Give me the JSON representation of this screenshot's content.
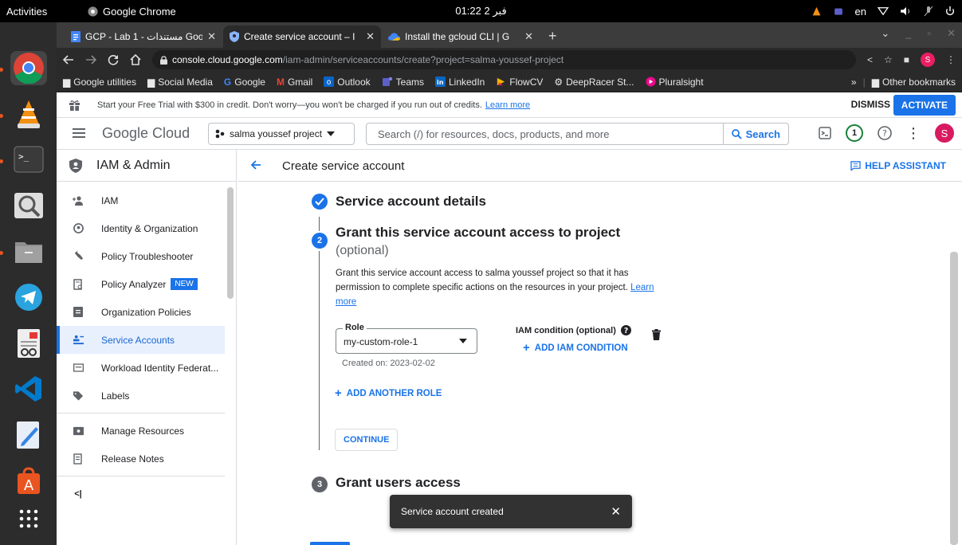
{
  "os": {
    "activities": "Activities",
    "app_name": "Google Chrome",
    "clock": "01:22 فبر 2",
    "language": "en"
  },
  "browser": {
    "tabs": [
      {
        "title": "GCP - Lab 1 - مستندات Goo",
        "icon": "docs-icon",
        "active": false
      },
      {
        "title": "Create service account – I",
        "icon": "iam-shield-icon",
        "active": true
      },
      {
        "title": "Install the gcloud CLI | G",
        "icon": "gcloud-icon",
        "active": false
      }
    ],
    "url_host": "console.cloud.google.com",
    "url_path": "/iam-admin/serviceaccounts/create?project=salma-youssef-project",
    "profile_initial": "S",
    "bookmarks": [
      {
        "label": "Google utilities",
        "icon": "folder-icon"
      },
      {
        "label": "Social Media",
        "icon": "folder-icon"
      },
      {
        "label": "Google",
        "icon": "google-icon"
      },
      {
        "label": "Gmail",
        "icon": "gmail-icon"
      },
      {
        "label": "Outlook",
        "icon": "outlook-icon"
      },
      {
        "label": "Teams",
        "icon": "teams-icon"
      },
      {
        "label": "LinkedIn",
        "icon": "linkedin-icon"
      },
      {
        "label": "FlowCV",
        "icon": "flowcv-icon"
      },
      {
        "label": "DeepRacer St...",
        "icon": "deepracer-icon"
      },
      {
        "label": "Pluralsight",
        "icon": "pluralsight-icon"
      }
    ],
    "bookmarks_more": "»",
    "other_bookmarks": "Other bookmarks"
  },
  "trial_banner": {
    "text": "Start your Free Trial with $300 in credit. Don't worry—you won't be charged if you run out of credits.",
    "link": "Learn more",
    "dismiss": "DISMISS",
    "activate": "ACTIVATE"
  },
  "header": {
    "logo": "Google Cloud",
    "project": "salma youssef project",
    "search_placeholder": "Search (/) for resources, docs, products, and more",
    "search_button": "Search",
    "notifications": "1",
    "user_initial": "S"
  },
  "sidebar": {
    "title": "IAM & Admin",
    "items": [
      {
        "label": "IAM",
        "icon": "person-add-icon"
      },
      {
        "label": "Identity & Organization",
        "icon": "account-circle-icon"
      },
      {
        "label": "Policy Troubleshooter",
        "icon": "wrench-icon"
      },
      {
        "label": "Policy Analyzer",
        "icon": "document-search-icon",
        "badge": "NEW"
      },
      {
        "label": "Organization Policies",
        "icon": "list-doc-icon"
      },
      {
        "label": "Service Accounts",
        "icon": "service-account-icon",
        "active": true
      },
      {
        "label": "Workload Identity Federat...",
        "icon": "id-card-icon"
      },
      {
        "label": "Labels",
        "icon": "label-icon"
      }
    ],
    "items2": [
      {
        "label": "Manage Resources",
        "icon": "resources-icon"
      },
      {
        "label": "Release Notes",
        "icon": "notes-icon"
      }
    ],
    "collapse": "<|"
  },
  "main": {
    "title": "Create service account",
    "help": "HELP ASSISTANT",
    "step1": {
      "title": "Service account details"
    },
    "step2": {
      "number": "2",
      "title": "Grant this service account access to project",
      "optional": "(optional)",
      "description": "Grant this service account access to salma youssef project so that it has permission to complete specific actions on the resources in your project.",
      "learn_more": "Learn more",
      "role_label": "Role",
      "role_value": "my-custom-role-1",
      "created_on": "Created on: 2023-02-02",
      "iam_condition_label": "IAM condition (optional)",
      "add_iam_condition": "ADD IAM CONDITION",
      "add_another_role": "ADD ANOTHER ROLE",
      "continue": "CONTINUE"
    },
    "step3": {
      "number": "3",
      "title": "Grant users access"
    }
  },
  "snackbar": {
    "message": "Service account created",
    "close": "✕"
  }
}
